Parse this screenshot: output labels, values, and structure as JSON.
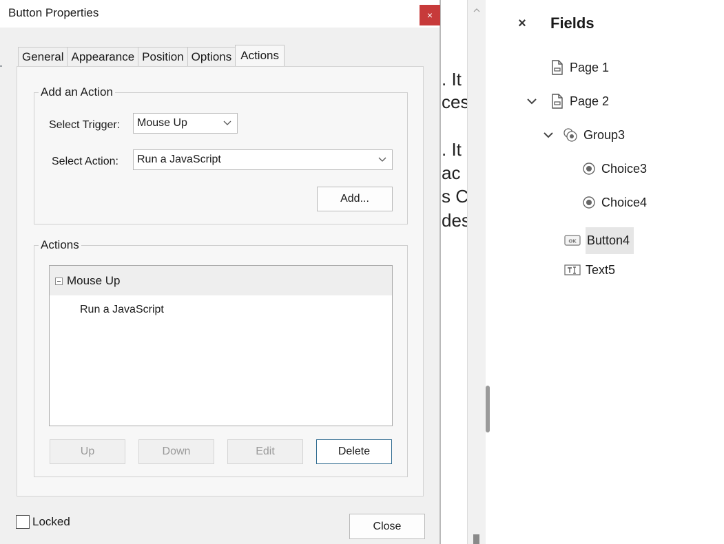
{
  "dialog": {
    "title": "Button Properties",
    "close_symbol": "×",
    "tabs": [
      {
        "label": "General",
        "active": false
      },
      {
        "label": "Appearance",
        "active": false
      },
      {
        "label": "Position",
        "active": false
      },
      {
        "label": "Options",
        "active": false
      },
      {
        "label": "Actions",
        "active": true
      }
    ],
    "add_action": {
      "group_title": "Add an Action",
      "trigger_label": "Select Trigger:",
      "trigger_value": "Mouse Up",
      "action_label": "Select Action:",
      "action_value": "Run a JavaScript",
      "add_button": "Add..."
    },
    "actions": {
      "group_title": "Actions",
      "tree_head": "Mouse Up",
      "tree_child": "Run a JavaScript",
      "buttons": {
        "up": "Up",
        "down": "Down",
        "edit": "Edit",
        "delete": "Delete"
      }
    },
    "locked_label": "Locked",
    "close_button": "Close"
  },
  "document": {
    "fragments": [
      ". It",
      "ces",
      ". It",
      "ac",
      "s Cl",
      "des"
    ]
  },
  "fields_panel": {
    "title": "Fields",
    "close_symbol": "×",
    "items": [
      {
        "label": "Page 1",
        "icon": "page-icon",
        "expanded": null
      },
      {
        "label": "Page 2",
        "icon": "page-icon",
        "expanded": true
      },
      {
        "label": "Group3",
        "icon": "radio-group-icon",
        "expanded": true
      },
      {
        "label": "Choice3",
        "icon": "radio-button-icon",
        "expanded": null
      },
      {
        "label": "Choice4",
        "icon": "radio-button-icon",
        "expanded": null
      },
      {
        "label": "Button4",
        "icon": "button-field-icon",
        "expanded": null,
        "selected": true
      },
      {
        "label": "Text5",
        "icon": "text-field-icon",
        "expanded": null
      }
    ]
  },
  "colors": {
    "close_red": "#c73a3a",
    "selection_gray": "#e6e6e6",
    "focus_blue": "#2d6a8f"
  }
}
